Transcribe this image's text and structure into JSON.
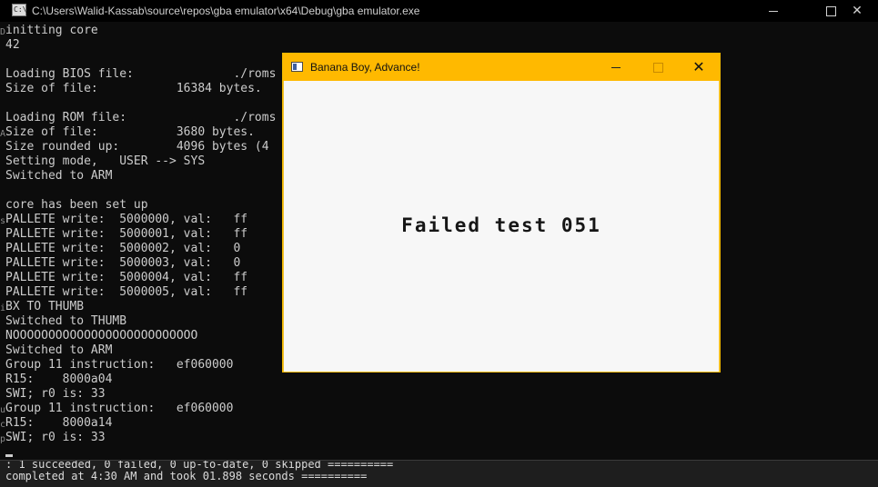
{
  "console_window": {
    "title": "C:\\Users\\Walid-Kassab\\source\\repos\\gba emulator\\x64\\Debug\\gba emulator.exe",
    "icon": "console-app-icon",
    "icon_text": "C:\\",
    "buttons": [
      "minimize",
      "maximize",
      "close"
    ],
    "close_glyph": "✕"
  },
  "console_lines": [
    "initting core",
    "42",
    "",
    "Loading BIOS file:              ./roms",
    "Size of file:           16384 bytes.",
    "",
    "Loading ROM file:               ./roms",
    "Size of file:           3680 bytes.",
    "Size rounded up:        4096 bytes (4",
    "Setting mode,   USER --> SYS",
    "Switched to ARM",
    "",
    "core has been set up",
    "PALLETE write:  5000000, val:   ff",
    "PALLETE write:  5000001, val:   ff",
    "PALLETE write:  5000002, val:   0",
    "PALLETE write:  5000003, val:   0",
    "PALLETE write:  5000004, val:   ff",
    "PALLETE write:  5000005, val:   ff",
    "BX TO THUMB",
    "Switched to THUMB",
    "NOOOOOOOOOOOOOOOOOOOOOOOOOO",
    "Switched to ARM",
    "Group 11 instruction:   ef060000",
    "R15:    8000a04",
    "SWI; r0 is: 33",
    "Group 11 instruction:   ef060000",
    "R15:    8000a14",
    "SWI; r0 is: 33"
  ],
  "side_marks": [
    {
      "line": 0,
      "text": "D"
    },
    {
      "line": 7,
      "text": "A"
    },
    {
      "line": 13,
      "text": "s"
    },
    {
      "line": 19,
      "text": "i"
    },
    {
      "line": 26,
      "text": "u"
    },
    {
      "line": 27,
      "text": "c"
    },
    {
      "line": 28,
      "text": "p"
    }
  ],
  "output_lines": [
    ": 1 succeeded, 0 failed, 0 up-to-date, 0 skipped ==========",
    "completed at 4:30 AM and took 01.898 seconds =========="
  ],
  "emulator_window": {
    "title": "Banana Boy, Advance!",
    "message": "Failed test 051",
    "titlebar_color": "#ffb900",
    "screen_color": "#f7f7f7",
    "close_glyph": "✕"
  }
}
